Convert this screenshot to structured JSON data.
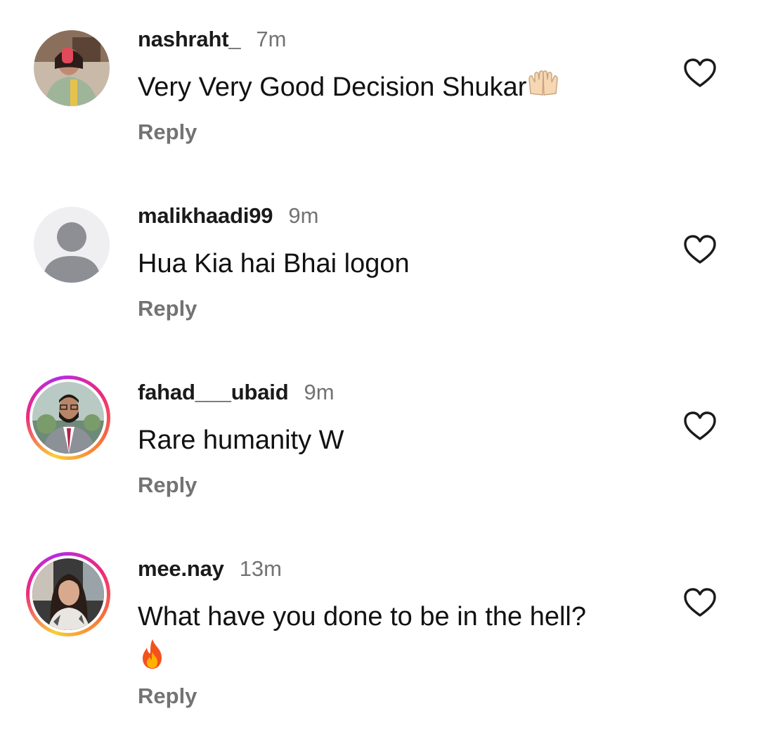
{
  "comments": [
    {
      "username": "nashraht_",
      "time": "7m",
      "text": "Very Very Good Decision Shukar",
      "emoji": "palms-up-together-icon",
      "reply_label": "Reply",
      "has_story": false,
      "avatar": "photo-woman-in-green"
    },
    {
      "username": "malikhaadi99",
      "time": "9m",
      "text": "Hua Kia hai Bhai logon",
      "reply_label": "Reply",
      "has_story": false,
      "avatar": "default-user-icon"
    },
    {
      "username": "fahad___ubaid",
      "time": "9m",
      "text": "Rare humanity W",
      "reply_label": "Reply",
      "has_story": true,
      "avatar": "photo-man-in-suit"
    },
    {
      "username": "mee.nay",
      "time": "13m",
      "text": "What have you done to be in the hell?",
      "emoji": "fire-icon",
      "reply_label": "Reply",
      "has_story": true,
      "avatar": "photo-woman-in-car"
    }
  ],
  "colors": {
    "muted": "#737373",
    "text": "#111111",
    "story_ring": [
      "#f9ce34",
      "#ee2a7b",
      "#b62ae6"
    ]
  }
}
